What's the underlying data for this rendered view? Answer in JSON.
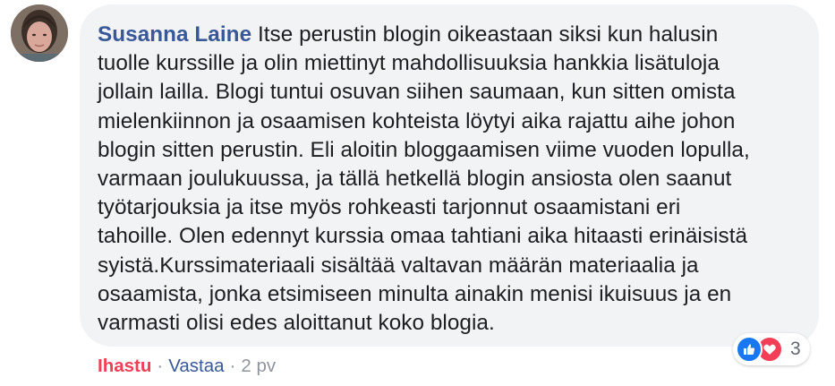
{
  "comment": {
    "author": "Susanna Laine",
    "text_lines": [
      " Itse perustin blogin oikeastaan siksi kun halusin",
      "tuolle kurssille ja olin miettinyt mahdollisuuksia hankkia lisätuloja",
      "jollain lailla. Blogi tuntui osuvan siihen saumaan, kun sitten omista",
      "mielenkiinnon ja osaamisen kohteista löytyi aika rajattu aihe johon",
      "blogin sitten perustin. Eli aloitin bloggaamisen viime vuoden lopulla,",
      "varmaan joulukuussa, ja tällä hetkellä blogin ansiosta olen saanut",
      "työtarjouksia ja itse myös rohkeasti tarjonnut osaamistani eri",
      "tahoille. Olen edennyt kurssia omaa tahtiani aika hitaasti erinäisistä",
      "syistä.Kurssimateriaali sisältää valtavan määrän materiaalia ja",
      "osaamista, jonka etsimiseen minulta ainakin menisi ikuisuus ja en",
      "varmasti olisi edes aloittanut koko blogia."
    ]
  },
  "reactions": {
    "icons": [
      "like-icon",
      "love-icon"
    ],
    "count": "3",
    "colors": {
      "like": "#1877f2",
      "love": "#f33e58"
    }
  },
  "actions": {
    "love_label": "Ihastu",
    "separator": "·",
    "reply_label": "Vastaa",
    "timestamp": "2 pv"
  },
  "colors": {
    "author": "#385898",
    "bubble": "#f2f3f5",
    "text": "#1c1e21",
    "meta": "#90949c"
  }
}
